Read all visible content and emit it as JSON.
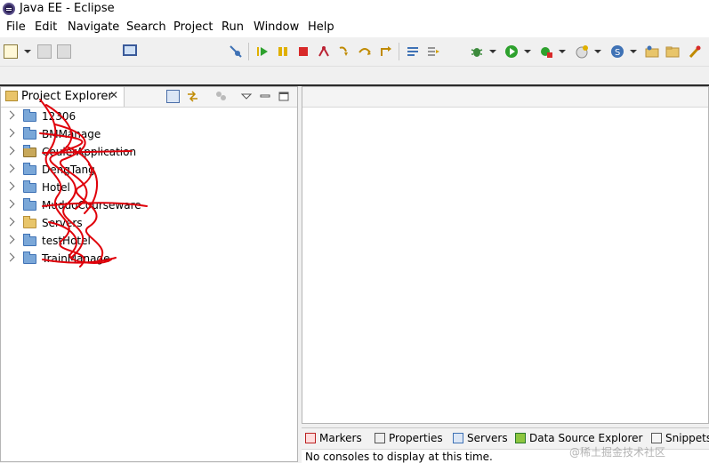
{
  "window": {
    "title": "Java EE - Eclipse"
  },
  "menu": [
    "File",
    "Edit",
    "Navigate",
    "Search",
    "Project",
    "Run",
    "Window",
    "Help"
  ],
  "toolbar_icons": [
    "new-icon",
    "save-icon",
    "save-all-icon",
    "monitor-icon",
    "skip-breakpoints-icon",
    "resume-icon",
    "suspend-icon",
    "terminate-icon",
    "disconnect-icon",
    "step-into-icon",
    "step-over-icon",
    "step-return-icon",
    "open-task-icon",
    "next-annotation-icon",
    "debug-icon",
    "run-icon",
    "external-tools-icon",
    "new-server-icon",
    "new-web-service-icon",
    "open-type-icon",
    "open-folder-icon",
    "build-icon"
  ],
  "explorer": {
    "title": "Project Explorer",
    "close": "✕",
    "projects": [
      {
        "name": "12306",
        "icon": "folder-icon"
      },
      {
        "name": "BMManage",
        "icon": "folder-icon"
      },
      {
        "name": "CeulerApplication",
        "icon": "web-project-icon"
      },
      {
        "name": "DengTang",
        "icon": "folder-icon"
      },
      {
        "name": "Hotel",
        "icon": "folder-icon"
      },
      {
        "name": "MuduoCourseware",
        "icon": "folder-icon"
      },
      {
        "name": "Servers",
        "icon": "open-folder-icon"
      },
      {
        "name": "testHotel",
        "icon": "folder-icon"
      },
      {
        "name": "TrainManage",
        "icon": "folder-icon"
      }
    ]
  },
  "bottom_panel": {
    "tabs": [
      "Markers",
      "Properties",
      "Servers",
      "Data Source Explorer",
      "Snippets"
    ],
    "message": "No consoles to display at this time."
  },
  "watermark": "@稀土掘金技术社区",
  "colors": {
    "accent": "#3f72b5",
    "scribble": "#e0000a"
  }
}
